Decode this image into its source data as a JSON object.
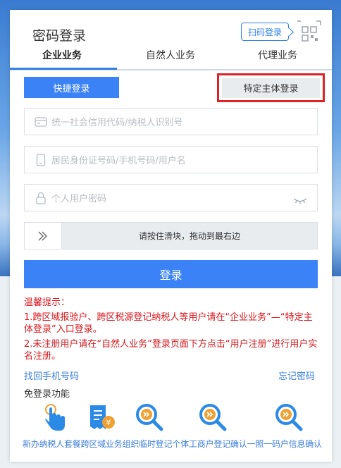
{
  "header": {
    "title": "密码登录",
    "qr_login_label": "扫码登录"
  },
  "tabs": [
    {
      "label": "企业业务",
      "active": true
    },
    {
      "label": "自然人业务",
      "active": false
    },
    {
      "label": "代理业务",
      "active": false
    }
  ],
  "login_mode": {
    "quick_login_label": "快捷登录",
    "special_entity_login_label": "特定主体登录"
  },
  "form": {
    "credit_code_placeholder": "统一社会信用代码/纳税人识别号",
    "identity_placeholder": "居民身份证号码/手机号码/用户名",
    "password_placeholder": "个人用户密码",
    "slider_text": "请按住滑块，拖动到最右边",
    "login_label": "登录"
  },
  "notice": {
    "title": "温馨提示：",
    "line1": "1.跨区域报验户、跨区税源登记纳税人等用户请在“企业业务”—“特定主体登录”入口登录。",
    "line2": "2.未注册用户请在“自然人业务”登录页面下方点击“用户注册”进行用户实名注册。"
  },
  "links": {
    "recover_phone": "找回手机号码",
    "forgot_password": "忘记密码"
  },
  "no_login": {
    "title": "免登录功能",
    "labels_line": "新办纳税人套餐跨区域业务组织临时登记个体工商户登记确认一照一码户信息确认",
    "items": [
      "新办纳税人套餐",
      "跨区域业务",
      "组织临时登记",
      "个体工商户登记确认",
      "一照一码户信息确认"
    ]
  },
  "colors": {
    "primary": "#3b82f6",
    "highlight_border": "#e01f26",
    "notice_red": "#d9161c",
    "link_blue": "#3b7ddd"
  }
}
